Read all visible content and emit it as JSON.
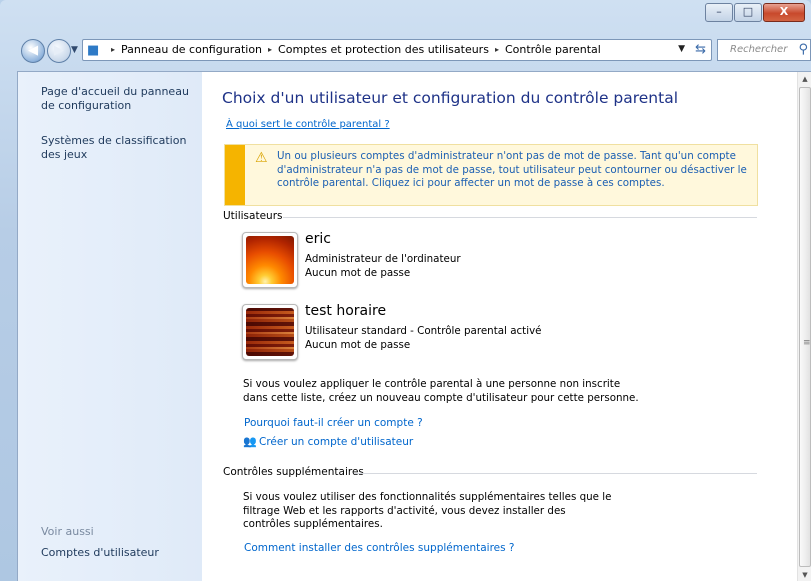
{
  "window": {
    "minimize_glyph": "–",
    "maximize_glyph": "□",
    "close_glyph": "X"
  },
  "address": {
    "crumbs": [
      "Panneau de configuration",
      "Comptes et protection des utilisateurs",
      "Contrôle parental"
    ],
    "separator": "▸",
    "search_placeholder": "Rechercher"
  },
  "sidebar": {
    "home_link": "Page d'accueil du panneau de configuration",
    "ratings_link": "Systèmes de classification des jeux",
    "see_also_label": "Voir aussi",
    "user_accounts_link": "Comptes d'utilisateur"
  },
  "main": {
    "title": "Choix d'un utilisateur et configuration du contrôle parental",
    "help_link": "À quoi sert le contrôle parental ?",
    "warning": "Un ou plusieurs comptes d'administrateur n'ont pas de mot de passe. Tant qu'un compte d'administrateur n'a pas de mot de passe, tout utilisateur peut contourner ou désactiver le contrôle parental. Cliquez ici pour affecter un mot de passe à ces comptes.",
    "users_section": "Utilisateurs",
    "users": [
      {
        "name": "eric",
        "role": "Administrateur de l'ordinateur",
        "password": "Aucun mot de passe"
      },
      {
        "name": "test horaire",
        "role": "Utilisateur standard - Contrôle parental activé",
        "password": "Aucun mot de passe"
      }
    ],
    "new_user_text": "Si vous voulez appliquer le contrôle parental à une personne non inscrite dans cette liste, créez un nouveau compte d'utilisateur pour cette personne.",
    "why_create_link": "Pourquoi faut-il créer un compte ?",
    "create_account_link": "Créer un compte d'utilisateur",
    "extra_section": "Contrôles supplémentaires",
    "extra_text": "Si vous voulez utiliser des fonctionnalités supplémentaires telles que le filtrage Web et les rapports d'activité, vous devez installer des contrôles supplémentaires.",
    "install_link": "Comment installer des contrôles supplémentaires ?"
  },
  "colors": {
    "title": "#1e3287",
    "link": "#0066cc",
    "warning_bar": "#f5b400",
    "warning_bg": "#fff8dc"
  }
}
